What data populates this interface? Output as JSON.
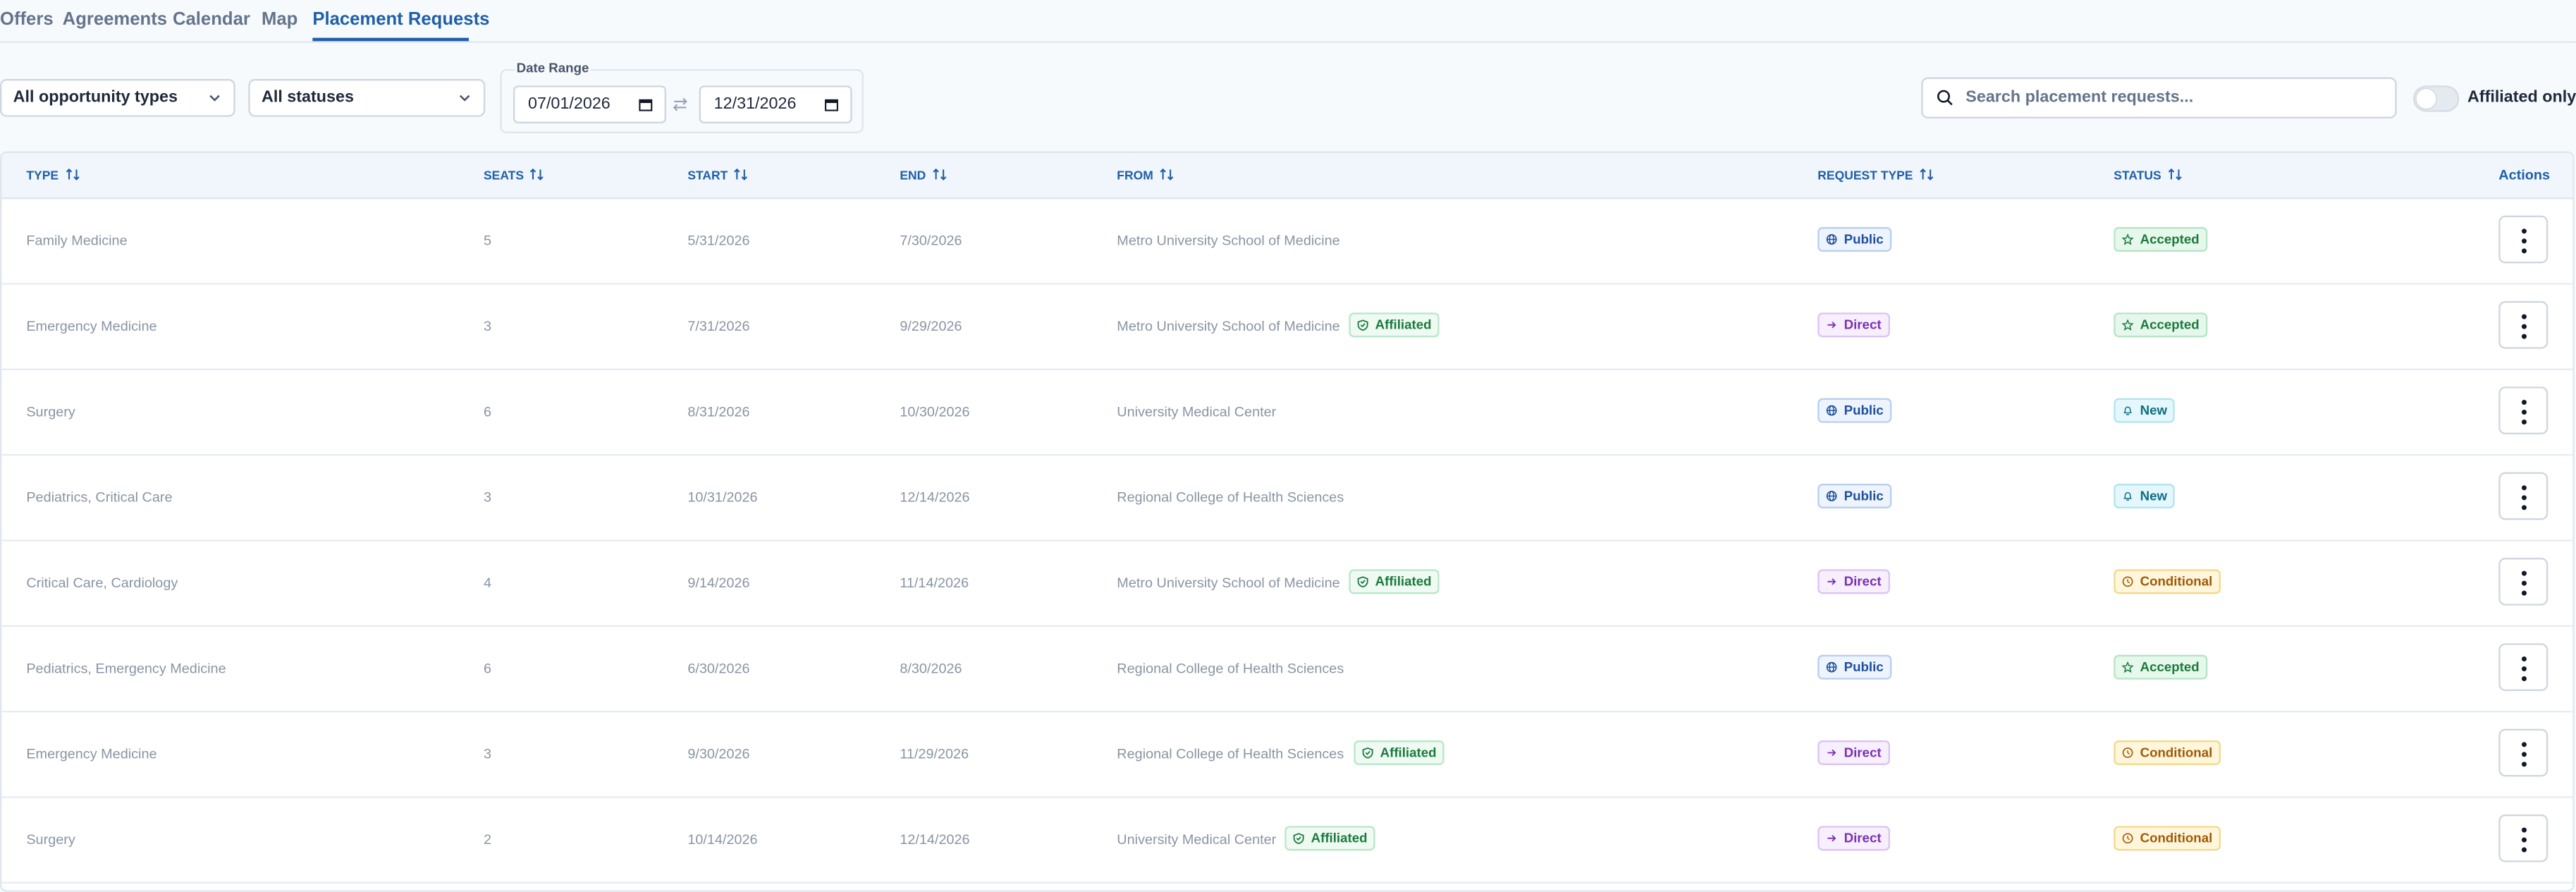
{
  "tabs": [
    "Offers",
    "Agreements",
    "Calendar",
    "Map",
    "Placement Requests"
  ],
  "active_tab": "Placement Requests",
  "filters": {
    "opportunity_type": "All opportunity types",
    "status": "All statuses",
    "date_range_label": "Date Range",
    "date_start": "07/01/2026",
    "date_end": "12/31/2026",
    "search_placeholder": "Search placement requests...",
    "affiliated_only_label": "Affiliated only",
    "affiliated_only": false
  },
  "table": {
    "columns": [
      "TYPE",
      "SEATS",
      "START",
      "END",
      "FROM",
      "REQUEST TYPE",
      "STATUS",
      "Actions"
    ],
    "rows": [
      {
        "type": "Family Medicine",
        "seats": "5",
        "start": "5/31/2026",
        "end": "7/30/2026",
        "from": "Metro University School of Medicine",
        "affiliated": "",
        "request_type": "Public",
        "status": "Accepted"
      },
      {
        "type": "Emergency Medicine",
        "seats": "3",
        "start": "7/31/2026",
        "end": "9/29/2026",
        "from": "Metro University School of Medicine",
        "affiliated": "Affiliated",
        "request_type": "Direct",
        "status": "Accepted"
      },
      {
        "type": "Surgery",
        "seats": "6",
        "start": "8/31/2026",
        "end": "10/30/2026",
        "from": "University Medical Center",
        "affiliated": "",
        "request_type": "Public",
        "status": "New"
      },
      {
        "type": "Pediatrics, Critical Care",
        "seats": "3",
        "start": "10/31/2026",
        "end": "12/14/2026",
        "from": "Regional College of Health Sciences",
        "affiliated": "",
        "request_type": "Public",
        "status": "New"
      },
      {
        "type": "Critical Care, Cardiology",
        "seats": "4",
        "start": "9/14/2026",
        "end": "11/14/2026",
        "from": "Metro University School of Medicine",
        "affiliated": "Affiliated",
        "request_type": "Direct",
        "status": "Conditional"
      },
      {
        "type": "Pediatrics, Emergency Medicine",
        "seats": "6",
        "start": "6/30/2026",
        "end": "8/30/2026",
        "from": "Regional College of Health Sciences",
        "affiliated": "",
        "request_type": "Public",
        "status": "Accepted"
      },
      {
        "type": "Emergency Medicine",
        "seats": "3",
        "start": "9/30/2026",
        "end": "11/29/2026",
        "from": "Regional College of Health Sciences",
        "affiliated": "Affiliated",
        "request_type": "Direct",
        "status": "Conditional"
      },
      {
        "type": "Surgery",
        "seats": "2",
        "start": "10/14/2026",
        "end": "12/14/2026",
        "from": "University Medical Center",
        "affiliated": "Affiliated",
        "request_type": "Direct",
        "status": "Conditional"
      }
    ]
  },
  "colors": {
    "accent": "#1f5fa8",
    "affiliated": "#1b7a3c",
    "public": "#1d4f9c",
    "direct": "#7a2fb4",
    "accepted": "#1b7a3c",
    "new": "#0f6f83",
    "conditional": "#a05a07"
  }
}
